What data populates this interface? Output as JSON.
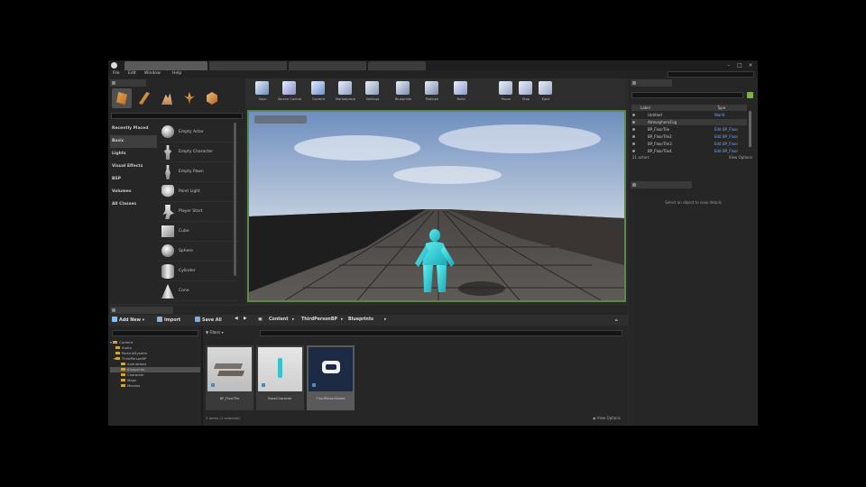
{
  "window": {
    "tabs": [
      "",
      "",
      "",
      ""
    ],
    "project_name": "",
    "search_help_placeholder": ""
  },
  "menu": {
    "items": [
      "File",
      "Edit",
      "Window",
      "Help"
    ]
  },
  "modes": {
    "tab_label": "",
    "search_placeholder": "",
    "categories": [
      "Recently Placed",
      "Basic",
      "Lights",
      "Visual Effects",
      "BSP",
      "Volumes",
      "All Classes"
    ],
    "items": [
      "Empty Actor",
      "Empty Character",
      "Empty Pawn",
      "Point Light",
      "Player Start",
      "Cube",
      "Sphere",
      "Cylinder",
      "Cone"
    ]
  },
  "toolbar": {
    "buttons": [
      {
        "label": "Save",
        "icon": "save-icon",
        "color": "#6a8fbf"
      },
      {
        "label": "Source Control",
        "icon": "source-control-icon",
        "color": "#8a8ad0"
      },
      {
        "label": "Content",
        "icon": "content-icon",
        "color": "#6a8fcf"
      },
      {
        "label": "Marketplace",
        "icon": "marketplace-icon",
        "color": "#8aa0c0"
      },
      {
        "label": "Settings",
        "icon": "settings-icon",
        "color": "#8a9ab8"
      },
      {
        "label": "Blueprints",
        "icon": "blueprints-icon",
        "color": "#7a8fb0"
      },
      {
        "label": "Matinee",
        "icon": "matinee-icon",
        "color": "#7a8aa8"
      },
      {
        "label": "Build",
        "icon": "build-icon",
        "color": "#8a9acf"
      },
      {
        "label": "Pause",
        "icon": "pause-icon",
        "color": "#9aa8c8"
      },
      {
        "label": "Stop",
        "icon": "stop-icon",
        "color": "#9aa8c8"
      },
      {
        "label": "Eject",
        "icon": "eject-icon",
        "color": "#9aa8c8"
      }
    ]
  },
  "outliner": {
    "tab_label": "",
    "search_placeholder": "",
    "col_label": "Label",
    "col_type": "Type",
    "rows": [
      {
        "name": "Untitled",
        "type": "World"
      },
      {
        "name": "AtmosphericFog",
        "type": ""
      },
      {
        "name": "BP_FloorTile",
        "type": "Edit BP_Floor"
      },
      {
        "name": "BP_FloorTile2",
        "type": "Edit BP_Floor"
      },
      {
        "name": "BP_FloorTile3",
        "type": "Edit BP_Floor"
      },
      {
        "name": "BP_FloorTile4",
        "type": "Edit BP_Floor"
      }
    ],
    "actor_count": "21 actors",
    "view_options": "View Options"
  },
  "details": {
    "tab_label": "",
    "hint": "Select an object to view details"
  },
  "content_browser": {
    "tab_label": "",
    "add_new": "Add New",
    "import": "Import",
    "save_all": "Save All",
    "path": [
      "Content",
      "ThirdPersonBP",
      "Blueprints"
    ],
    "filters": "Filters",
    "search_folders_placeholder": "",
    "search_assets_placeholder": "",
    "tree": [
      "Content",
      "Audio",
      "ParticleSystem",
      "ThirdPersonBP",
      "Animations",
      "Blueprints",
      "Character",
      "Maps",
      "Meshes"
    ],
    "assets": [
      "BP_FloorTile",
      "BaseCharacter",
      "ThirdPersonGame"
    ],
    "footer": "3 items (1 selected)",
    "view_options": "View Options"
  }
}
